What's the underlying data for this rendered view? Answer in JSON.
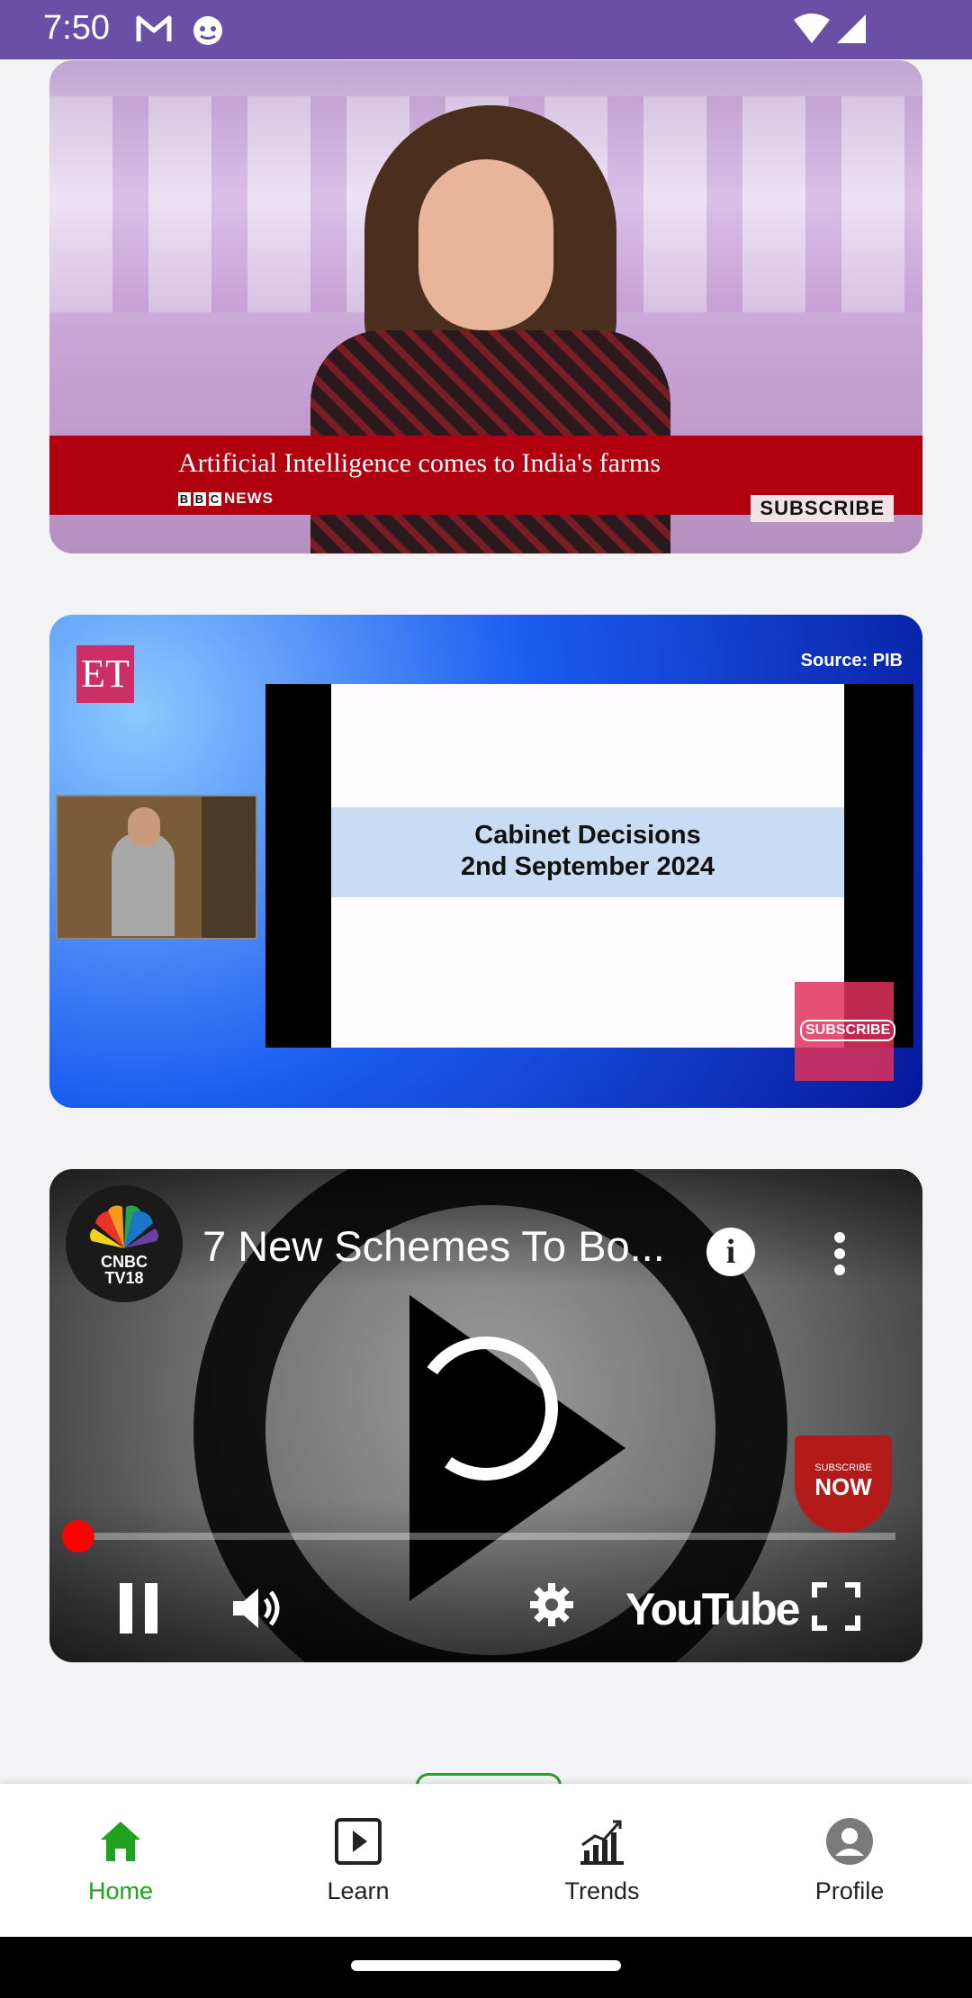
{
  "status_bar": {
    "time": "7:50",
    "icons": [
      "gmail-icon",
      "app-notification-icon",
      "wifi-icon",
      "signal-icon"
    ]
  },
  "videos": [
    {
      "headline": "Artificial Intelligence comes to India's farms",
      "brand": "NEWS",
      "brand_letters": [
        "B",
        "B",
        "C"
      ],
      "subscribe": "SUBSCRIBE"
    },
    {
      "logo": "ET",
      "source": "Source: PIB",
      "slide_line1": "Cabinet Decisions",
      "slide_line2": "2nd September 2024",
      "subscribe": "SUBSCRIBE"
    },
    {
      "channel_line1": "CNBC",
      "channel_line2": "TV18",
      "title": "7 New Schemes To Bo...",
      "info": "i",
      "subscribe_small": "SUBSCRIBE",
      "subscribe_big": "NOW",
      "wordmark": "YouTube",
      "progress_fraction": 0.02
    }
  ],
  "bottom_nav": {
    "items": [
      {
        "label": "Home",
        "icon": "home-icon",
        "active": true
      },
      {
        "label": "Learn",
        "icon": "play-box-icon",
        "active": false
      },
      {
        "label": "Trends",
        "icon": "trending-chart-icon",
        "active": false
      },
      {
        "label": "Profile",
        "icon": "profile-icon",
        "active": false
      }
    ]
  },
  "colors": {
    "status_bar": "#6a4fa6",
    "active": "#1fa31f",
    "bbc_red": "#b0000f",
    "youtube_red": "#ff0000"
  }
}
